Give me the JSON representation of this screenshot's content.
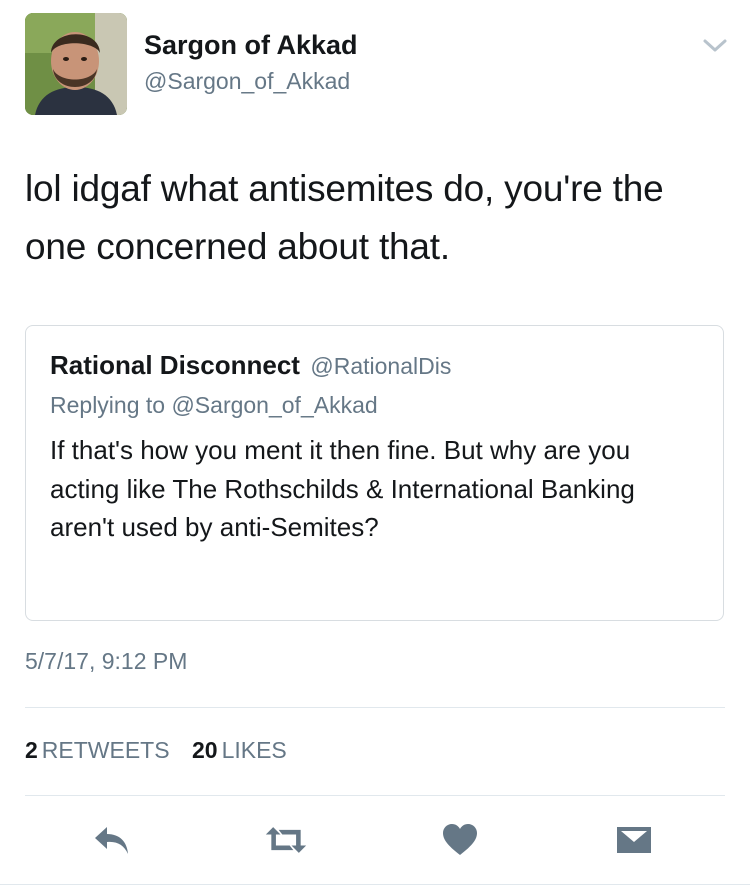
{
  "author": {
    "name": "Sargon of Akkad",
    "handle": "@Sargon_of_Akkad"
  },
  "tweet": {
    "text": "lol idgaf what antisemites do, you're the one concerned about that.",
    "timestamp": "5/7/17, 9:12 PM"
  },
  "quoted_tweet": {
    "name": "Rational Disconnect",
    "handle": "@RationalDis",
    "replying_to": "Replying to @Sargon_of_Akkad",
    "text": "If that's how you ment it then fine. But why are you acting like The Rothschilds & International Banking aren't used by anti-Semites?"
  },
  "stats": {
    "retweets_count": "2",
    "retweets_label": "RETWEETS",
    "likes_count": "20",
    "likes_label": "LIKES"
  },
  "actions": [
    {
      "name": "reply",
      "icon": "reply-icon"
    },
    {
      "name": "retweet",
      "icon": "retweet-icon"
    },
    {
      "name": "like",
      "icon": "heart-icon"
    },
    {
      "name": "message",
      "icon": "envelope-icon"
    }
  ],
  "colors": {
    "text_primary": "#14171a",
    "text_secondary": "#657786",
    "icon": "#657786",
    "border": "#d8dde1"
  }
}
